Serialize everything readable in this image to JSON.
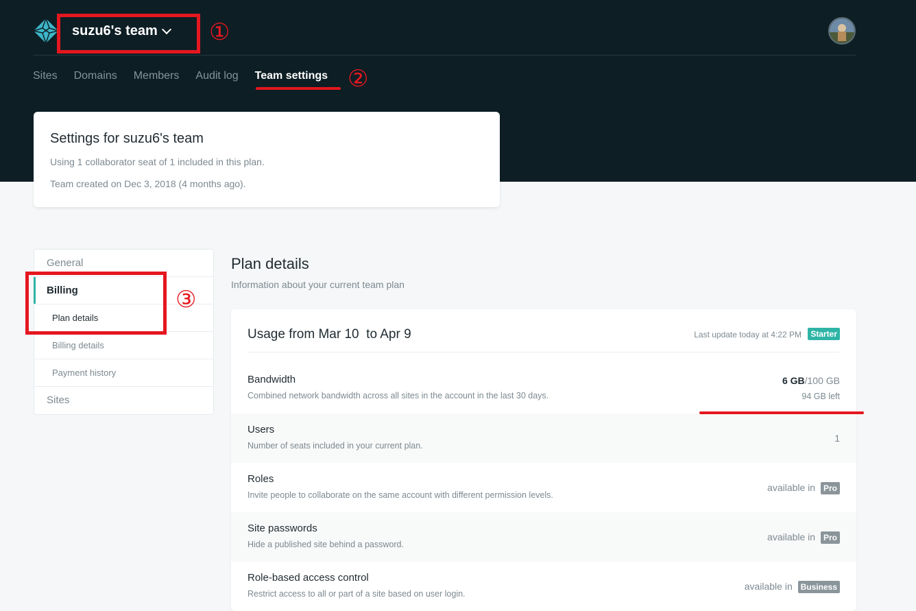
{
  "header": {
    "team_name": "suzu6's team",
    "nav": [
      "Sites",
      "Domains",
      "Members",
      "Audit log",
      "Team settings"
    ],
    "active_nav": "Team settings"
  },
  "annotations": {
    "one": "①",
    "two": "②",
    "three": "③",
    "color": "#e5171f"
  },
  "settings_card": {
    "title": "Settings for suzu6's team",
    "seats": "Using 1 collaborator seat of 1 included in this plan.",
    "created": "Team created on Dec 3, 2018 (4 months ago)."
  },
  "sidebar": {
    "general": "General",
    "billing": "Billing",
    "plan_details": "Plan details",
    "billing_details": "Billing details",
    "payment_history": "Payment history",
    "sites": "Sites"
  },
  "main": {
    "title": "Plan details",
    "subtitle": "Information about your current team plan"
  },
  "usage": {
    "heading": "Usage from Mar 10  to Apr 9",
    "last_update": "Last update today at 4:22 PM",
    "plan_badge": "Starter",
    "rows": [
      {
        "title": "Bandwidth",
        "desc": "Combined network bandwidth across all sites in the account in the last 30 days.",
        "used": "6 GB",
        "total": "/100 GB",
        "left": "94 GB left"
      },
      {
        "title": "Users",
        "desc": "Number of seats included in your current plan.",
        "value": "1"
      },
      {
        "title": "Roles",
        "desc": "Invite people to collaborate on the same account with different permission levels.",
        "available": "available in",
        "badge": "Pro"
      },
      {
        "title": "Site passwords",
        "desc": "Hide a published site behind a password.",
        "available": "available in",
        "badge": "Pro"
      },
      {
        "title": "Role-based access control",
        "desc": "Restrict access to all or part of a site based on user login.",
        "available": "available in",
        "badge": "Business"
      }
    ]
  },
  "colors": {
    "header_bg": "#0e1e25",
    "accent": "#2eb4a6",
    "badge_gray": "#8a959a"
  }
}
